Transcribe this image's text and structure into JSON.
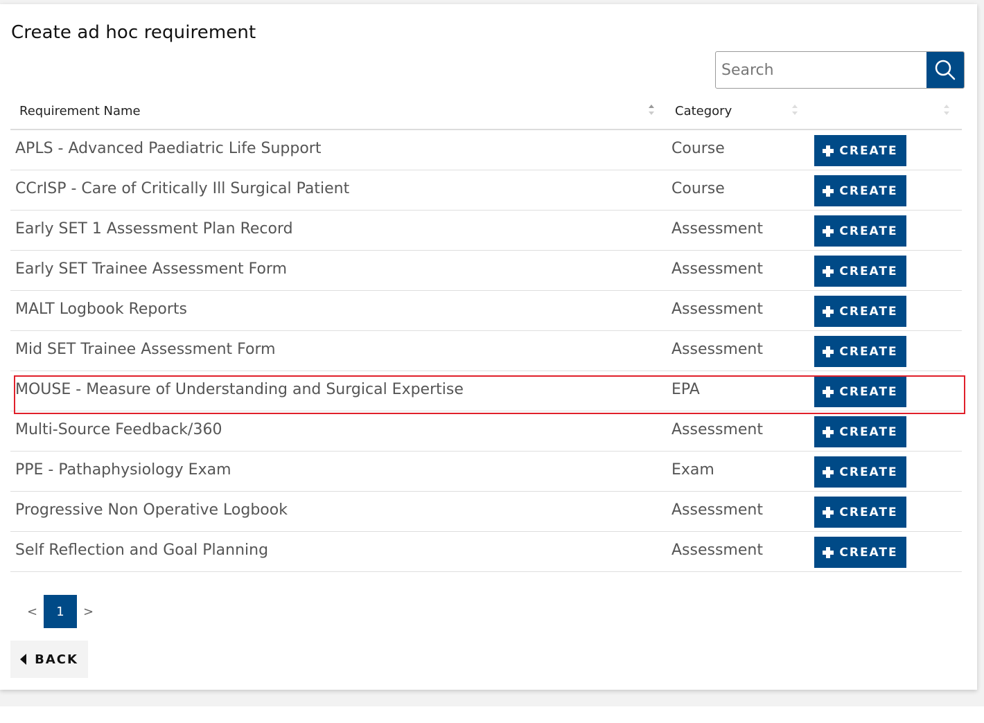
{
  "page": {
    "title": "Create ad hoc requirement"
  },
  "search": {
    "placeholder": "Search",
    "value": ""
  },
  "table": {
    "headers": {
      "name": "Requirement Name",
      "category": "Category",
      "action": ""
    },
    "rows": [
      {
        "name": "APLS - Advanced Paediatric Life Support",
        "category": "Course",
        "action": "CREATE"
      },
      {
        "name": "CCrISP - Care of Critically Ill Surgical Patient",
        "category": "Course",
        "action": "CREATE"
      },
      {
        "name": "Early SET 1 Assessment Plan Record",
        "category": "Assessment",
        "action": "CREATE"
      },
      {
        "name": "Early SET Trainee Assessment Form",
        "category": "Assessment",
        "action": "CREATE"
      },
      {
        "name": "MALT Logbook Reports",
        "category": "Assessment",
        "action": "CREATE"
      },
      {
        "name": "Mid SET Trainee Assessment Form",
        "category": "Assessment",
        "action": "CREATE"
      },
      {
        "name": "MOUSE - Measure of Understanding and Surgical Expertise",
        "category": "EPA",
        "action": "CREATE",
        "highlighted": true
      },
      {
        "name": "Multi-Source Feedback/360",
        "category": "Assessment",
        "action": "CREATE"
      },
      {
        "name": "PPE - Pathaphysiology Exam",
        "category": "Exam",
        "action": "CREATE"
      },
      {
        "name": "Progressive Non Operative Logbook",
        "category": "Assessment",
        "action": "CREATE"
      },
      {
        "name": "Self Reflection and Goal Planning",
        "category": "Assessment",
        "action": "CREATE"
      }
    ]
  },
  "pagination": {
    "prev": "<",
    "current": "1",
    "next": ">"
  },
  "back": {
    "label": "BACK"
  },
  "colors": {
    "primary": "#004a87",
    "highlight": "#e0202a"
  }
}
